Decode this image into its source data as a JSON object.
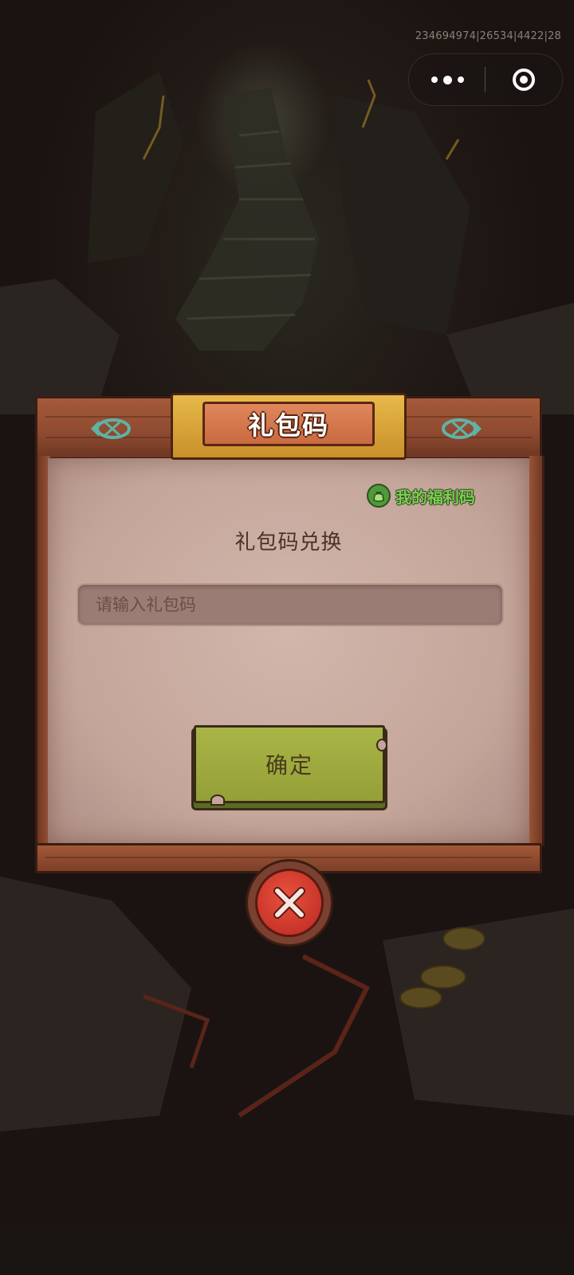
{
  "status": {
    "session_id": "234694974|26534|4422|28"
  },
  "capsule": {
    "more_icon": "more-dots-icon",
    "close_icon": "mini-program-close-icon"
  },
  "dialog": {
    "title": "礼包码",
    "welfare_link": "我的福利码",
    "subtitle": "礼包码兑换",
    "input": {
      "value": "",
      "placeholder": "请输入礼包码"
    },
    "confirm_label": "确定",
    "close_icon": "close-x-icon"
  },
  "colors": {
    "frame_wood": "#a55a3a",
    "panel": "#c9aba0",
    "plaque_gold": "#e7b94a",
    "plaque_orange": "#d97a4d",
    "confirm_green": "#a0ad40",
    "welfare_green": "#7ad04f",
    "close_red": "#d63b2d",
    "fish_teal": "#5fb3a6"
  }
}
